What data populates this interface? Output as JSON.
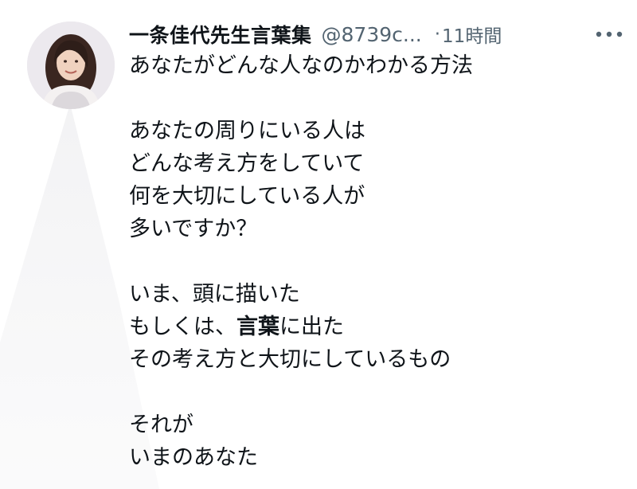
{
  "tweet": {
    "author_name": "一条佳代先生言葉集",
    "handle": "@8739c...",
    "separator": "·",
    "time": "11時間",
    "more_icon": "more-horizontal-icon",
    "avatar_icon": "profile-photo",
    "lines": [
      "あなたがどんな人なのかわかる方法",
      "",
      "あなたの周りにいる人は",
      "どんな考え方をしていて",
      "何を大切にしている人が",
      "多いですか？",
      "",
      "いま、頭に描いた",
      "",
      "その考え方と大切にしているもの",
      "",
      "それが",
      "いまのあなた"
    ],
    "line_8": {
      "before": "もしくは、",
      "bold": "言葉",
      "after": "に出た"
    }
  },
  "colors": {
    "text": "#0f1419",
    "secondary": "#536471",
    "background": "#ffffff"
  }
}
